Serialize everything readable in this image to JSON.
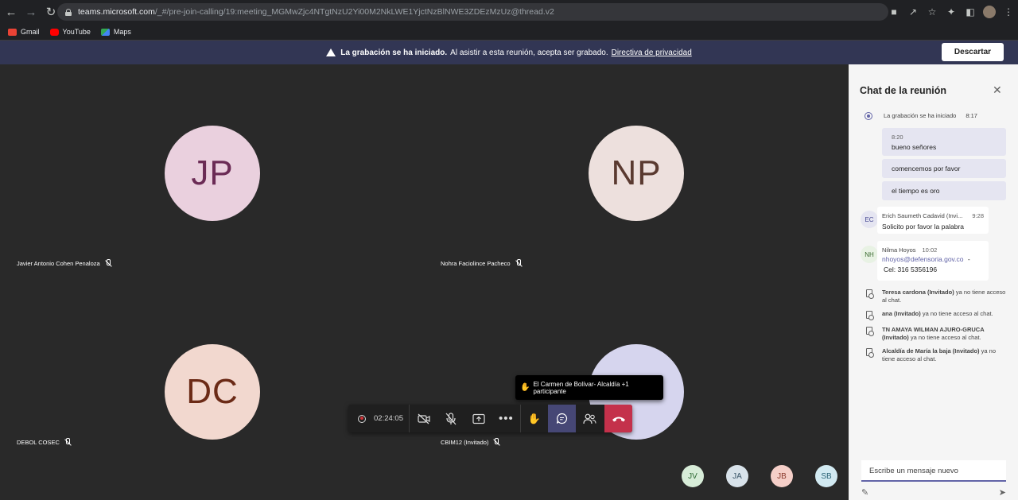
{
  "browser": {
    "url_host": "teams.microsoft.com",
    "url_path": "/_#/pre-join-calling/19:meeting_MGMwZjc4NTgtNzU2Yi00M2NkLWE1YjctNzBlNWE3ZDEzMzUz@thread.v2"
  },
  "bookmarks": [
    {
      "label": "Gmail",
      "color": "#ea4335"
    },
    {
      "label": "YouTube",
      "color": "#ff0000"
    },
    {
      "label": "Maps",
      "color": "#34a853"
    }
  ],
  "banner": {
    "bold": "La grabación se ha iniciado.",
    "text": "Al asistir a esta reunión, acepta ser grabado.",
    "link": "Directiva de privacidad",
    "dismiss": "Descartar"
  },
  "tiles": [
    {
      "initials": "JP",
      "name": "Javier Antonio Cohen Penaloza",
      "bg": "#ead0de",
      "fg": "#6b2b55"
    },
    {
      "initials": "NP",
      "name": "Nohra Faciolince Pacheco",
      "bg": "#ede0dd",
      "fg": "#5a3a30"
    },
    {
      "initials": "DC",
      "name": "DEBOL COSEC",
      "bg": "#f2d8cf",
      "fg": "#6b2a16"
    },
    {
      "initials": "",
      "name": "CBIM12 (Invitado)",
      "bg": "#d6d5ee",
      "fg": "#444791"
    }
  ],
  "toolbar": {
    "timer": "02:24:05",
    "tooltip": "El Carmen de Bolívar- Alcaldía +1 participante"
  },
  "small_avatars": [
    {
      "initials": "JV",
      "bg": "#d7ecd8",
      "fg": "#2f6b35"
    },
    {
      "initials": "JA",
      "bg": "#d8e2ea",
      "fg": "#3a5568"
    },
    {
      "initials": "JB",
      "bg": "#f5cfc8",
      "fg": "#8a3a2c"
    },
    {
      "initials": "SB",
      "bg": "#d2eaf2",
      "fg": "#2b6477"
    }
  ],
  "chat": {
    "title": "Chat de la reunión",
    "system_recording": "La grabación se ha iniciado",
    "system_time": "8:17",
    "my_time": "8:20",
    "my_messages": [
      "bueno señores",
      "comencemos por favor",
      "el tiempo es oro"
    ],
    "messages": [
      {
        "avatar": "EC",
        "avatar_bg": "#e5e5f1",
        "avatar_fg": "#444791",
        "author": "Erich Saumeth Cadavid (Invi...",
        "time": "9:28",
        "body": "Solicito por favor la palabra"
      },
      {
        "avatar": "NH",
        "avatar_bg": "#e8f2e4",
        "avatar_fg": "#3a6a30",
        "author": "Nilma Hoyos",
        "time": "10:02",
        "email": "nhoyos@defensoria.gov.co",
        "dash": "-",
        "body": "Cel: 316 5356196"
      }
    ],
    "access_notices": [
      {
        "name": "Teresa cardona (Invitado)",
        "text": "ya no tiene acceso al chat."
      },
      {
        "name": "ana (Invitado)",
        "text": "ya no tiene acceso al chat."
      },
      {
        "name": "TN AMAYA WILMAN AJURO-GRUCA (Invitado)",
        "text": "ya no tiene acceso al chat."
      },
      {
        "name": "Alcaldía de María la baja (Invitado)",
        "text": "ya no tiene acceso al chat."
      }
    ],
    "compose_placeholder": "Escribe un mensaje nuevo"
  }
}
